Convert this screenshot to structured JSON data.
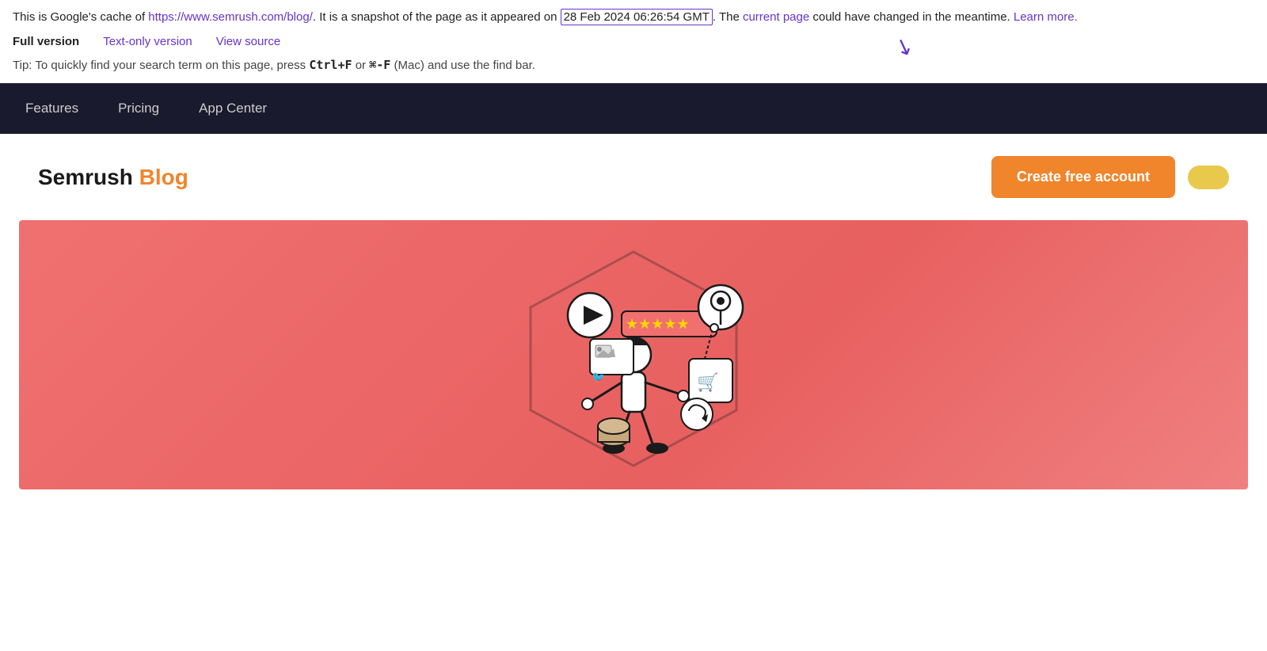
{
  "cache_bar": {
    "prefix": "This is Google's cache of ",
    "url": "https://www.semrush.com/blog/",
    "mid": ". It is a snapshot of the page as it appeared on ",
    "date": "28 Feb 2024 06:26:54 GMT",
    "suffix": ". The ",
    "current_page": "current page",
    "could_change": " could have changed in the meantime. ",
    "learn_more": "Learn more."
  },
  "version_bar": {
    "full_version": "Full version",
    "text_only": "Text-only version",
    "view_source": "View source"
  },
  "tip": {
    "text": "Tip: To quickly find your search term on this page, press ",
    "key1": "Ctrl+F",
    "mid": " or ",
    "key2": "⌘-F",
    "suffix": " (Mac) and use the find bar."
  },
  "nav": {
    "items": [
      {
        "label": "Features"
      },
      {
        "label": "Pricing"
      },
      {
        "label": "App Center"
      }
    ]
  },
  "blog_header": {
    "brand": "Semrush",
    "blog": "Blog",
    "create_btn": "Create free account"
  },
  "hero": {
    "alt": "Semrush Blog hero illustration"
  }
}
